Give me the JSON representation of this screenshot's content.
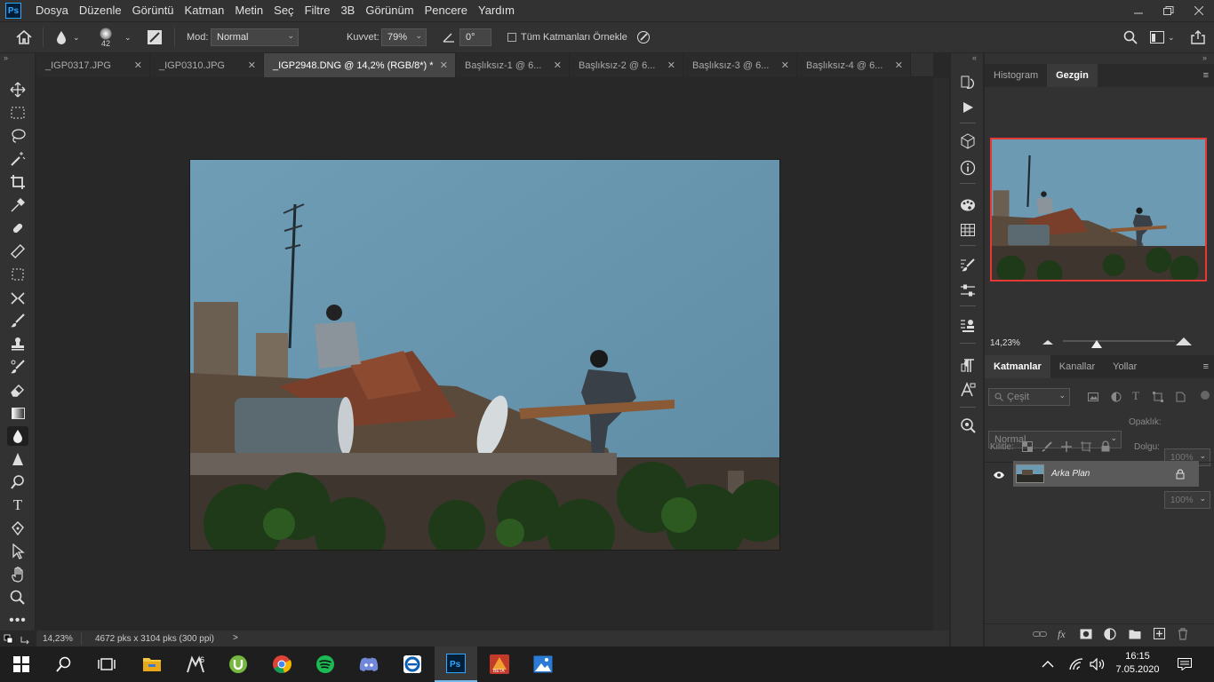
{
  "menubar": {
    "logo": "Ps",
    "items": [
      "Dosya",
      "Düzenle",
      "Görüntü",
      "Katman",
      "Metin",
      "Seç",
      "Filtre",
      "3B",
      "Görünüm",
      "Pencere",
      "Yardım"
    ]
  },
  "options": {
    "brush_size": "42",
    "mode_label": "Mod:",
    "mode_value": "Normal",
    "strength_label": "Kuvvet:",
    "strength_value": "79%",
    "angle_value": "0°",
    "sample_all_label": "Tüm Katmanları Örnekle"
  },
  "tabs": [
    {
      "label": "_IGP0317.JPG"
    },
    {
      "label": "_IGP0310.JPG"
    },
    {
      "label": "_IGP2948.DNG @ 14,2% (RGB/8*) *"
    },
    {
      "label": "Başlıksız-1 @ 6..."
    },
    {
      "label": "Başlıksız-2 @ 6..."
    },
    {
      "label": "Başlıksız-3 @ 6..."
    },
    {
      "label": "Başlıksız-4 @ 6..."
    }
  ],
  "active_tab_index": 2,
  "status": {
    "zoom": "14,23%",
    "doc_size": "4672 pks x 3104 pks (300 ppi)",
    "arrow": ">"
  },
  "navigator_panel": {
    "tabs": [
      "Histogram",
      "Gezgin"
    ],
    "zoom": "14,23%",
    "zoom_slider_fraction": 0.3
  },
  "layers_panel": {
    "tabs": [
      "Katmanlar",
      "Kanallar",
      "Yollar"
    ],
    "filter_placeholder": "Çeşit",
    "blend_mode": "Normal",
    "opacity_label": "Opaklık:",
    "opacity_value": "100%",
    "lock_label": "Kilitle:",
    "fill_label": "Dolgu:",
    "fill_value": "100%",
    "layers": [
      {
        "name": "Arka Plan",
        "visible": true,
        "locked": true
      }
    ]
  },
  "taskbar": {
    "time": "16:15",
    "date": "7.05.2020",
    "badge_count": "6",
    "beta_label": "BETA"
  },
  "colors": {
    "accent": "#31a8ff",
    "nav_frame": "#e53935",
    "sky": "#6e9cb4"
  }
}
